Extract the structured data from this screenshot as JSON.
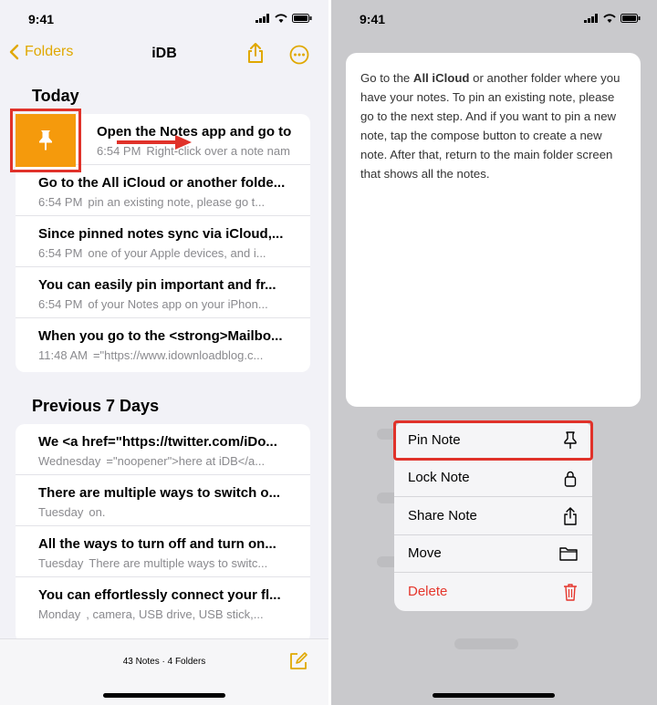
{
  "left": {
    "status_time": "9:41",
    "nav": {
      "back_label": "Folders",
      "title": "iDB"
    },
    "sections": [
      {
        "title": "Today",
        "notes": [
          {
            "title": "Open the Notes app and go to",
            "date": "6:54 PM",
            "snippet": "Right-click over a note nam"
          },
          {
            "title": "Go to the All iCloud or another folde...",
            "date": "6:54 PM",
            "snippet": "pin an existing note, please go t..."
          },
          {
            "title": "Since pinned notes sync via iCloud,...",
            "date": "6:54 PM",
            "snippet": "one of your Apple devices, and i..."
          },
          {
            "title": "You can easily pin important and fr...",
            "date": "6:54 PM",
            "snippet": "of your Notes app on your iPhon..."
          },
          {
            "title": "When you go to the <strong>Mailbo...",
            "date": "11:48 AM",
            "snippet": "=\"https://www.idownloadblog.c..."
          }
        ]
      },
      {
        "title": "Previous 7 Days",
        "notes": [
          {
            "title": "We <a href=\"https://twitter.com/iDo...",
            "date": "Wednesday",
            "snippet": "=\"noopener\">here at iDB</a..."
          },
          {
            "title": "There are multiple ways to switch o...",
            "date": "Tuesday",
            "snippet": "on."
          },
          {
            "title": "All the ways to turn off and turn on...",
            "date": "Tuesday",
            "snippet": "There are multiple ways to switc..."
          },
          {
            "title": "You can effortlessly connect your fl...",
            "date": "Monday",
            "snippet": ", camera, USB drive, USB stick,..."
          }
        ]
      }
    ],
    "toolbar_count": "43 Notes · 4 Folders",
    "accent_color": "#e0a800",
    "highlight_color": "#e0322a"
  },
  "right": {
    "status_time": "9:41",
    "preview": {
      "before": "Go to the ",
      "bold": "All iCloud",
      "after": " or another folder where you have your notes. To pin an existing note, please go to the next step. And if you want to pin a new note, tap the compose button to create a new note. After that, return to the main folder screen that shows all the notes."
    },
    "menu": [
      {
        "label": "Pin Note",
        "icon": "pin-icon"
      },
      {
        "label": "Lock Note",
        "icon": "lock-icon"
      },
      {
        "label": "Share Note",
        "icon": "share-icon"
      },
      {
        "label": "Move",
        "icon": "folder-icon"
      },
      {
        "label": "Delete",
        "icon": "trash-icon"
      }
    ],
    "delete_color": "#e5352b"
  }
}
